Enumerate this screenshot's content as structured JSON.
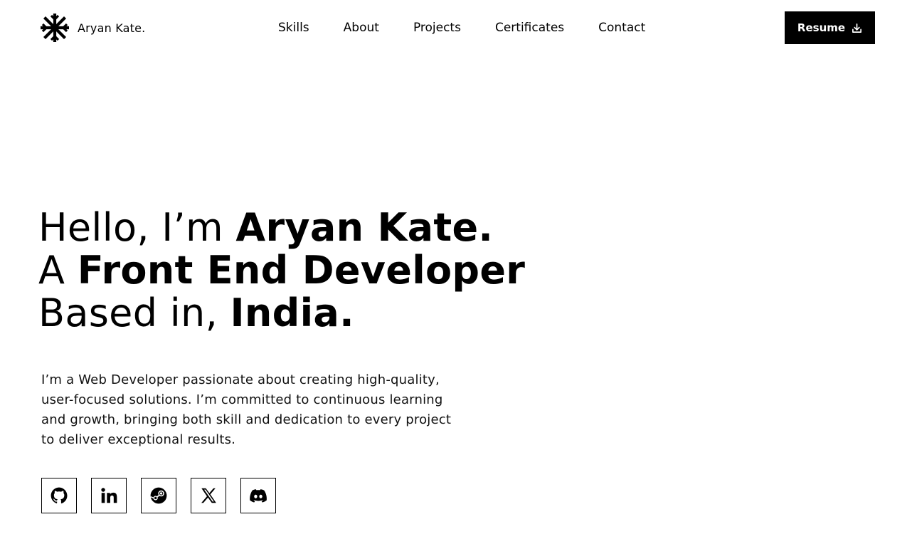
{
  "brand": {
    "name": "Aryan Kate.",
    "logo_icon": "asterisk-snowflake-icon"
  },
  "nav": {
    "items": [
      {
        "label": "Skills"
      },
      {
        "label": "About"
      },
      {
        "label": "Projects"
      },
      {
        "label": "Certificates"
      },
      {
        "label": "Contact"
      }
    ]
  },
  "resume_button": {
    "label": "Resume",
    "icon": "download-icon"
  },
  "hero": {
    "line1_light": "Hello, I’m ",
    "line1_bold": "Aryan Kate.",
    "line2_light": "A ",
    "line2_bold": "Front End Developer",
    "line3_light": "Based in, ",
    "line3_bold": "India."
  },
  "description": "I’m a Web Developer passionate about creating high-quality, user-focused solutions. I’m committed to continuous learning and growth, bringing both skill and dedication to every project to deliver exceptional results.",
  "socials": [
    {
      "icon": "github-icon"
    },
    {
      "icon": "linkedin-icon"
    },
    {
      "icon": "steam-icon"
    },
    {
      "icon": "x-twitter-icon"
    },
    {
      "icon": "discord-icon"
    }
  ],
  "colors": {
    "background": "#ffffff",
    "text": "#000000",
    "button_bg": "#000000",
    "button_text": "#ffffff"
  }
}
